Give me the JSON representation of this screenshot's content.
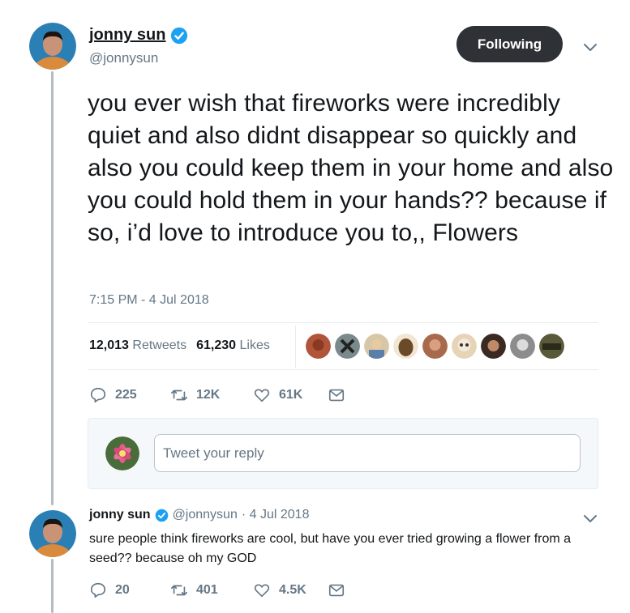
{
  "tweet": {
    "author_name": "jonny sun",
    "author_handle": "@jonnysun",
    "follow_label": "Following",
    "text": "you ever wish that fireworks were incredibly quiet and also didnt disappear so quickly and also you could keep them in your home and also you could hold them in your hands?? because if so, i’d love to introduce you to,, Flowers",
    "timestamp": "7:15 PM - 4 Jul 2018",
    "retweets_count": "12,013",
    "retweets_label": "Retweets",
    "likes_count": "61,230",
    "likes_label": "Likes",
    "actions": {
      "replies": "225",
      "retweets": "12K",
      "likes": "61K"
    }
  },
  "reply_composer": {
    "placeholder": "Tweet your reply"
  },
  "reply": {
    "author_name": "jonny sun",
    "author_handle": "@jonnysun",
    "date": "· 4 Jul 2018",
    "text": "sure people think fireworks are cool, but have you ever tried growing a flower from a seed?? because oh my GOD",
    "actions": {
      "replies": "20",
      "retweets": "401",
      "likes": "4.5K"
    }
  },
  "colors": {
    "verified": "#1da1f2",
    "secondary_text": "#657786",
    "follow_button": "#2e3135"
  },
  "likers": [
    "#b0553a",
    "#7a8a8c",
    "#d7c7a8",
    "#6b4a2a",
    "#a86a4c",
    "#e7d3b6",
    "#3b2a22",
    "#8c8c8c",
    "#5a5a3a"
  ]
}
